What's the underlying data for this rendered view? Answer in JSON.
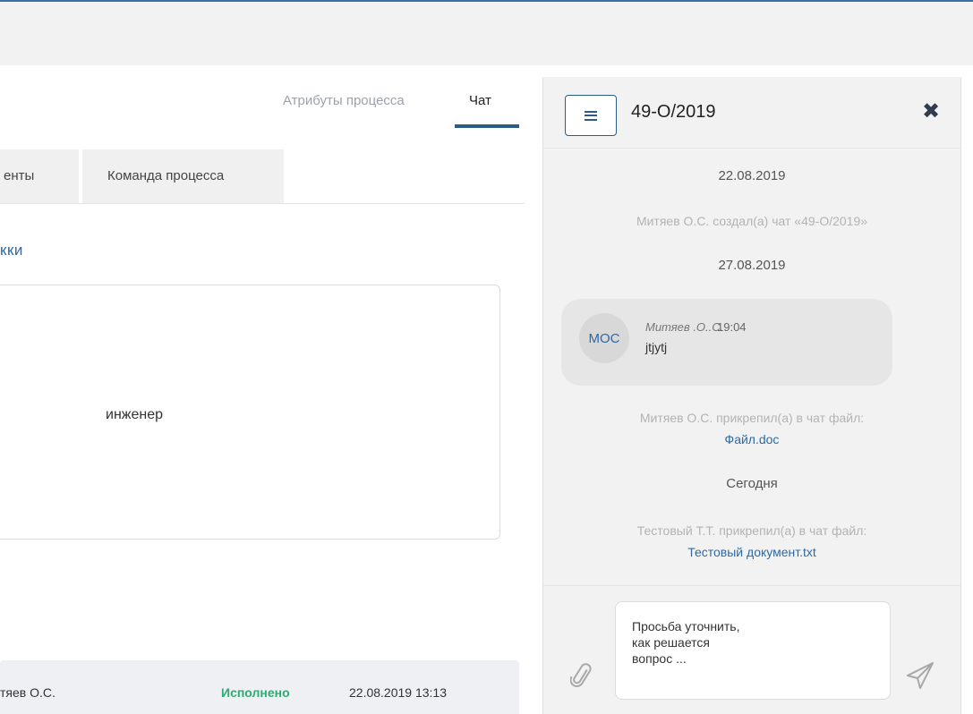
{
  "process_tabs": {
    "attributes_label": "Атрибуты процесса",
    "chat_label": "Чат"
  },
  "sub_tabs": {
    "documents_label": "енты",
    "team_label": "Команда процесса"
  },
  "section": {
    "heading": "кки",
    "card_value": "инженер"
  },
  "history_row": {
    "person": "тяев О.С.",
    "status": "Исполнено",
    "datetime": "22.08.2019 13:13"
  },
  "chat": {
    "title": "49-О/2019",
    "entries": {
      "date_1": "22.08.2019",
      "created_notice": "Митяев О.С. создал(а) чат «49-О/2019»",
      "date_2": "27.08.2019",
      "attach_notice_1": "Митяев О.С. прикрепил(а) в чат файл:",
      "attach_file_1": "Файл.doc",
      "date_today": "Сегодня",
      "attach_notice_2": "Тестовый Т.Т. прикрепил(а) в чат файл:",
      "attach_file_2": "Тестовый документ.txt"
    },
    "message": {
      "avatar_initials": "МОС",
      "author": "Митяев .О..С.",
      "time": "19:04",
      "text": "jtjytj"
    },
    "composer": {
      "draft": "Просьба уточнить,\nкак решается\nвопрос ..."
    }
  },
  "colors": {
    "accent": "#2c5b8a",
    "link": "#2d6aa5",
    "status_done": "#2eaa74",
    "panel_bg": "#f2f2f2"
  },
  "icons": {
    "menu": "menu-icon",
    "close": "close-icon",
    "attach": "paperclip-icon",
    "send": "send-icon"
  }
}
